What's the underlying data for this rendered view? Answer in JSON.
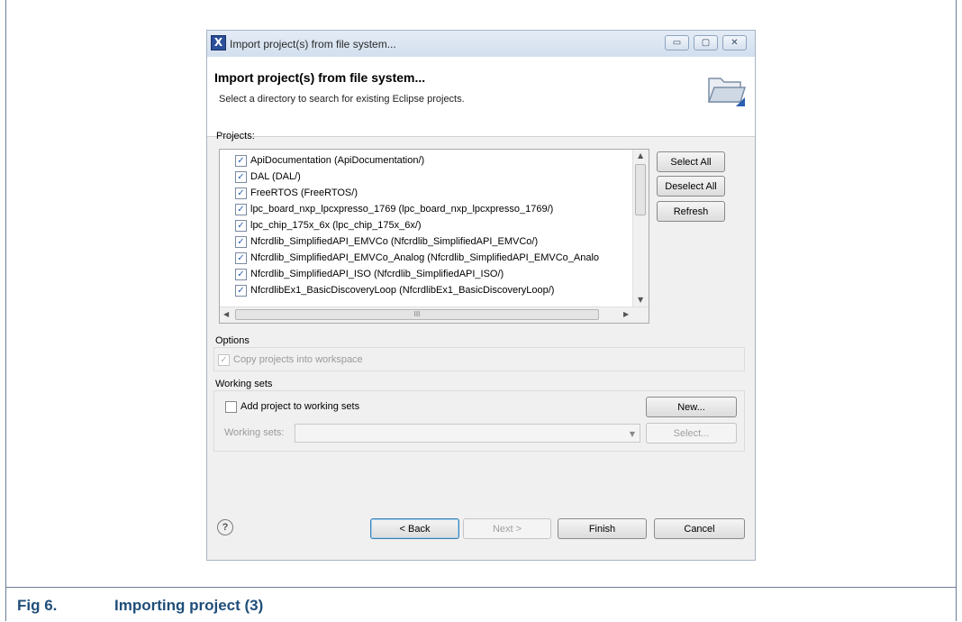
{
  "dialog": {
    "window_title": "Import project(s) from file system...",
    "app_icon": "X",
    "minimize_glyph": "▭",
    "maximize_glyph": "▢",
    "close_glyph": "✕",
    "header_title": "Import project(s) from file system...",
    "header_description": "Select a directory to search for existing Eclipse projects."
  },
  "projects": {
    "label": "Projects:",
    "items": [
      {
        "label": "ApiDocumentation (ApiDocumentation/)",
        "checked": true
      },
      {
        "label": "DAL (DAL/)",
        "checked": true
      },
      {
        "label": "FreeRTOS (FreeRTOS/)",
        "checked": true
      },
      {
        "label": "lpc_board_nxp_lpcxpresso_1769 (lpc_board_nxp_lpcxpresso_1769/)",
        "checked": true
      },
      {
        "label": "lpc_chip_175x_6x (lpc_chip_175x_6x/)",
        "checked": true
      },
      {
        "label": "Nfcrdlib_SimplifiedAPI_EMVCo (Nfcrdlib_SimplifiedAPI_EMVCo/)",
        "checked": true
      },
      {
        "label": "Nfcrdlib_SimplifiedAPI_EMVCo_Analog (Nfcrdlib_SimplifiedAPI_EMVCo_Analo",
        "checked": true
      },
      {
        "label": "Nfcrdlib_SimplifiedAPI_ISO (Nfcrdlib_SimplifiedAPI_ISO/)",
        "checked": true
      },
      {
        "label": "NfcrdlibEx1_BasicDiscoveryLoop (NfcrdlibEx1_BasicDiscoveryLoop/)",
        "checked": true
      }
    ],
    "select_all": "Select All",
    "deselect_all": "Deselect All",
    "refresh": "Refresh",
    "scroll_hint": "III"
  },
  "options": {
    "label": "Options",
    "copy_into_workspace": "Copy projects into workspace",
    "copy_checked": true
  },
  "working_sets": {
    "label": "Working sets",
    "add_to_working_sets": "Add project to working sets",
    "add_checked": false,
    "new_button": "New...",
    "field_label": "Working sets:",
    "field_value": "",
    "select_button": "Select..."
  },
  "footer": {
    "help_icon": "?",
    "back": "< Back",
    "next": "Next >",
    "finish": "Finish",
    "cancel": "Cancel"
  },
  "caption": {
    "number": "Fig 6.",
    "text": "Importing project (3)"
  }
}
